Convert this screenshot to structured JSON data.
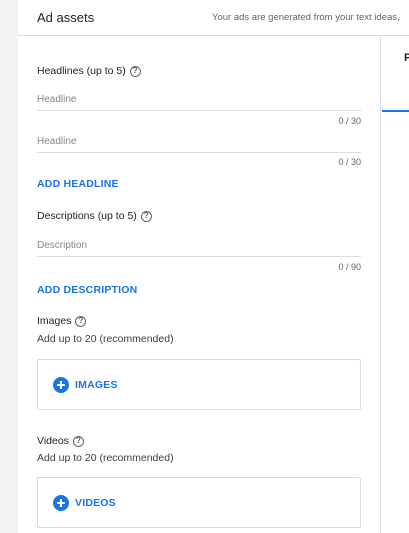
{
  "header": {
    "title": "Ad assets",
    "subtitle": "Your ads are generated from your text ideas,"
  },
  "preview": {
    "tab_label": "P"
  },
  "headlines": {
    "label": "Headlines (up to 5)",
    "help_glyph": "?",
    "fields": [
      {
        "placeholder": "Headline",
        "value": "",
        "counter": "0 / 30"
      },
      {
        "placeholder": "Headline",
        "value": "",
        "counter": "0 / 30"
      }
    ],
    "add_label": "ADD HEADLINE"
  },
  "descriptions": {
    "label": "Descriptions (up to 5)",
    "help_glyph": "?",
    "fields": [
      {
        "placeholder": "Description",
        "value": "",
        "counter": "0 / 90"
      }
    ],
    "add_label": "ADD DESCRIPTION"
  },
  "images": {
    "label": "Images",
    "help_glyph": "?",
    "note": "Add up to 20 (recommended)",
    "button_label": "IMAGES"
  },
  "videos": {
    "label": "Videos",
    "help_glyph": "?",
    "note": "Add up to 20 (recommended)",
    "button_label": "VIDEOS"
  },
  "colors": {
    "accent": "#1a73e8",
    "text": "#202124",
    "muted": "#5f6368",
    "divider": "#dadce0"
  }
}
